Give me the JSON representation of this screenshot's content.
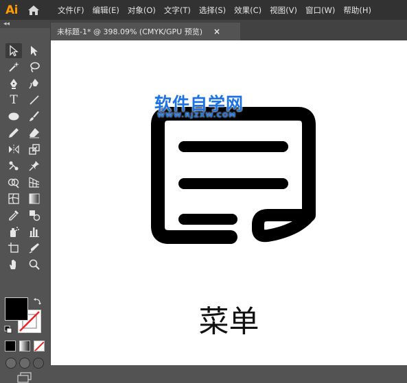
{
  "app": {
    "logo": "Ai"
  },
  "menu": [
    "文件(F)",
    "编辑(E)",
    "对象(O)",
    "文字(T)",
    "选择(S)",
    "效果(C)",
    "视图(V)",
    "窗口(W)",
    "帮助(H)"
  ],
  "document": {
    "tab_title": "未标题-1* @ 398.09% (CMYK/GPU 预览)",
    "close_glyph": "×"
  },
  "toolbar": {
    "collapse_glyph": "◂◂",
    "tools": [
      "selection-tool",
      "direct-selection-tool",
      "magic-wand-tool",
      "lasso-tool",
      "pen-tool",
      "curvature-tool",
      "type-tool",
      "line-segment-tool",
      "ellipse-tool",
      "paintbrush-tool",
      "pencil-tool",
      "eraser-tool",
      "reflect-tool",
      "scale-tool",
      "puppet-warp-tool",
      "pin-tool",
      "shape-builder-tool",
      "perspective-grid-tool",
      "mesh-tool",
      "gradient-tool",
      "eyedropper-tool",
      "blend-tool",
      "symbol-sprayer-tool",
      "column-graph-tool",
      "artboard-tool",
      "slice-tool",
      "hand-tool",
      "zoom-tool"
    ],
    "type_tool_glyph": "T",
    "fill_color": "#000000",
    "stroke_color": "none"
  },
  "canvas": {
    "watermark_title": "软件自学网",
    "watermark_url": "WWW.RJZXW.COM",
    "caption": "菜单",
    "icon": "note-menu-icon",
    "background": "#ffffff",
    "watermark_color": "#1e73e4"
  }
}
